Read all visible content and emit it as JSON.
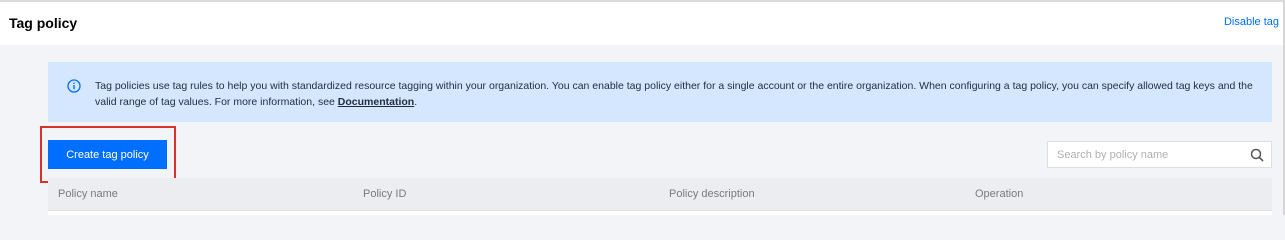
{
  "header": {
    "title": "Tag policy",
    "disable_link": "Disable tag"
  },
  "info_banner": {
    "icon": "info-icon",
    "text": "Tag policies use tag rules to help you with standardized resource tagging within your organization. You can enable tag policy either for a single account or the entire organization. When configuring a tag policy, you can specify allowed tag keys and the valid range of tag values. For more information, see ",
    "link_label": "Documentation",
    "text_end": "."
  },
  "toolbar": {
    "create_label": "Create tag policy",
    "search_placeholder": "Search by policy name",
    "search_icon": "search-icon"
  },
  "table": {
    "columns": [
      "Policy name",
      "Policy ID",
      "Policy description",
      "Operation"
    ]
  },
  "colors": {
    "accent": "#006eff",
    "banner_bg": "#d5e7fe",
    "highlight": "#d9322b"
  }
}
